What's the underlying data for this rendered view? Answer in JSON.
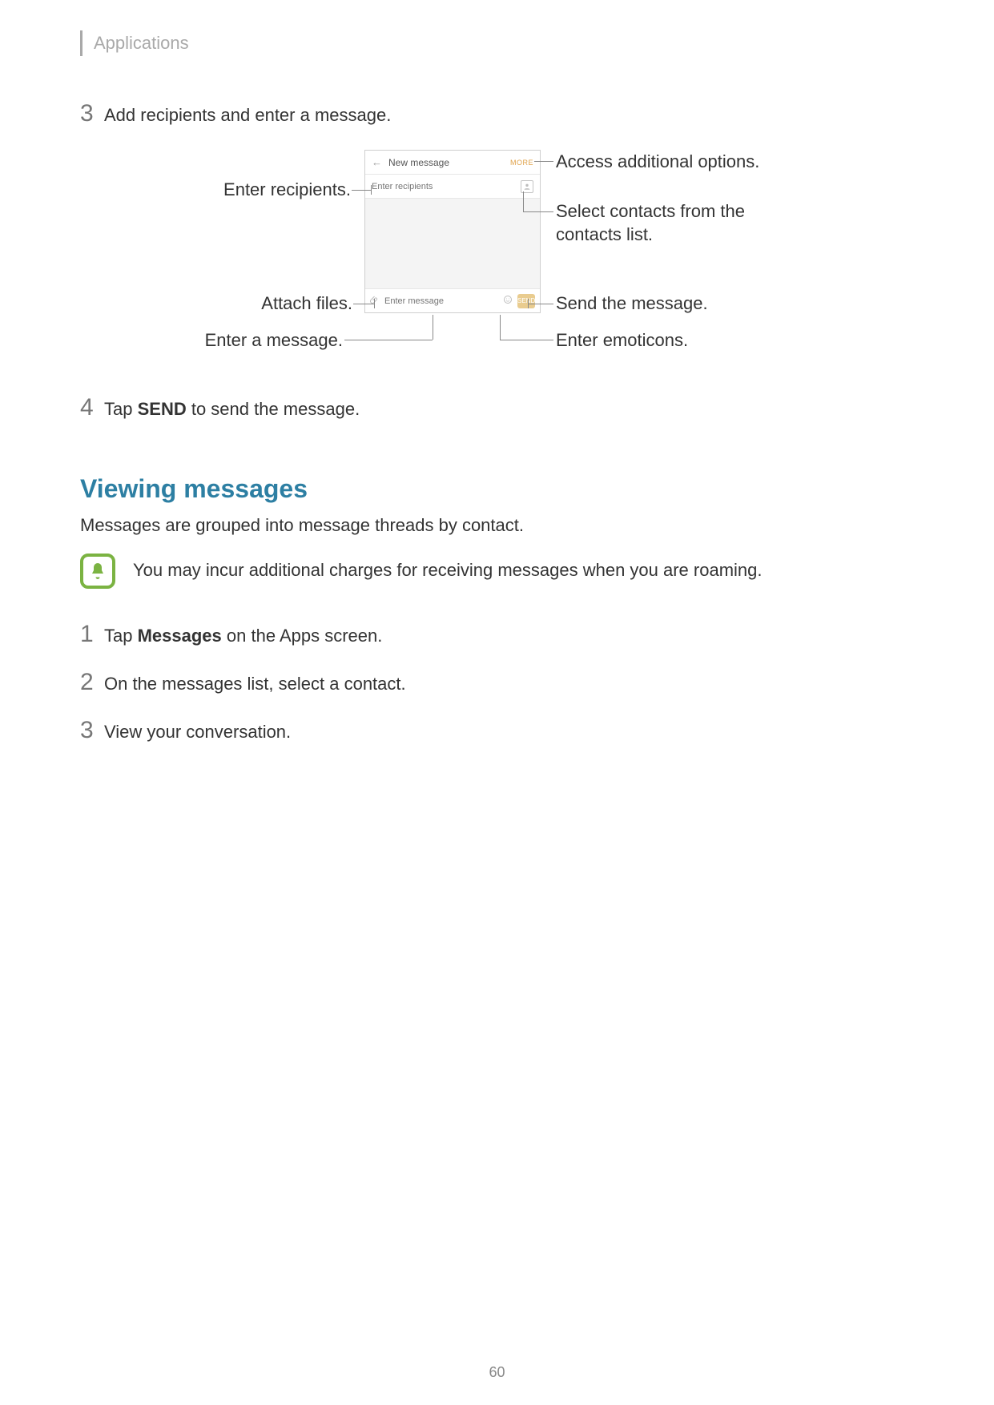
{
  "header": {
    "title": "Applications"
  },
  "steps_top": [
    {
      "num": "3",
      "text": "Add recipients and enter a message."
    },
    {
      "num": "4",
      "pre": "Tap ",
      "bold": "SEND",
      "post": " to send the message."
    }
  ],
  "phone": {
    "title": "New message",
    "more": "MORE",
    "recipients_placeholder": "Enter recipients",
    "message_placeholder": "Enter message",
    "send": "SEND"
  },
  "callouts": {
    "enter_recipients": "Enter recipients.",
    "attach_files": "Attach files.",
    "enter_message": "Enter a message.",
    "access_more": "Access additional options.",
    "select_contacts": "Select contacts from the contacts list.",
    "send_msg": "Send the message.",
    "enter_emoticons": "Enter emoticons."
  },
  "section_heading": "Viewing messages",
  "section_para": "Messages are grouped into message threads by contact.",
  "note": "You may incur additional charges for receiving messages when you are roaming.",
  "steps_bottom": [
    {
      "num": "1",
      "pre": "Tap ",
      "bold": "Messages",
      "post": " on the Apps screen."
    },
    {
      "num": "2",
      "text": "On the messages list, select a contact."
    },
    {
      "num": "3",
      "text": "View your conversation."
    }
  ],
  "page_number": "60"
}
